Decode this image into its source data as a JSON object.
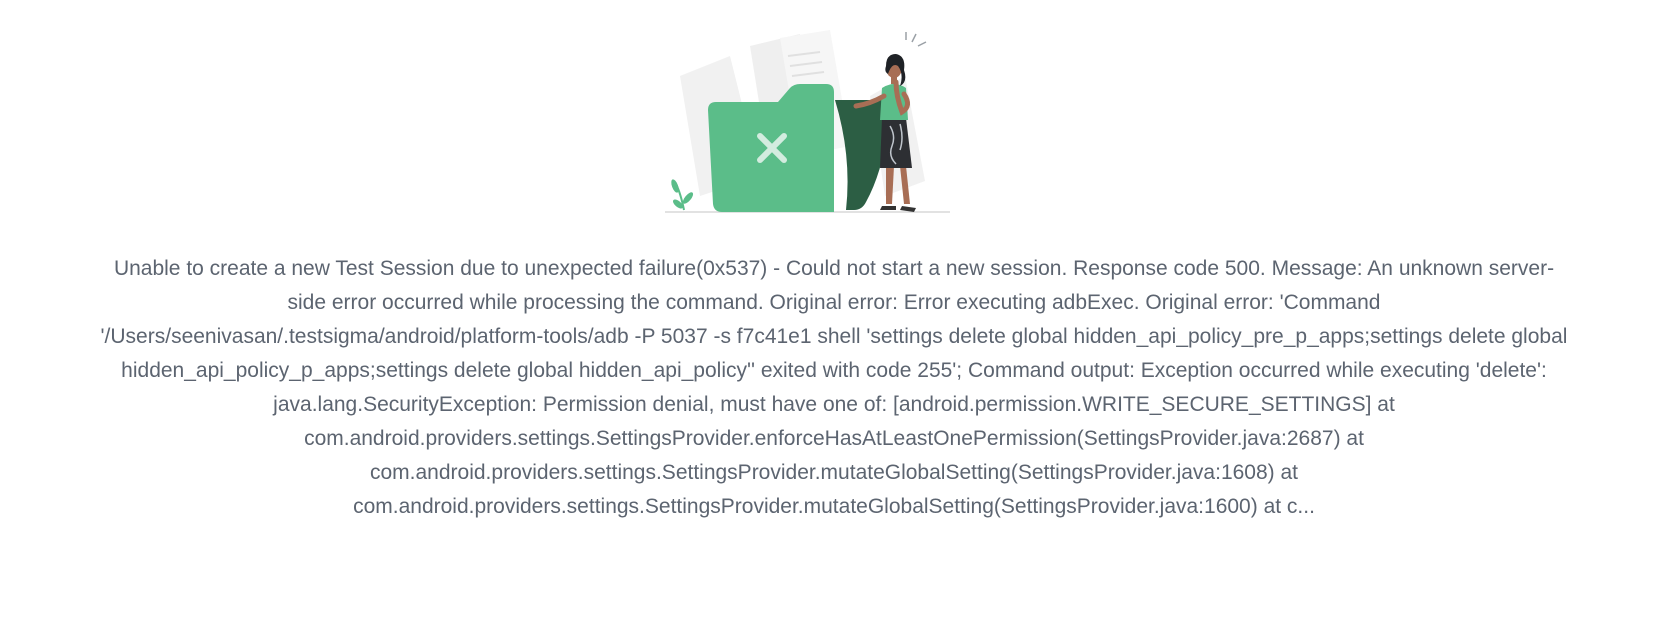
{
  "empty_state": {
    "illustration": {
      "icon": "error-folder-illustration",
      "accent_color": "#5bbd89",
      "dark_color": "#2c5e44"
    },
    "message": "Unable to create a new Test Session due to unexpected failure(0x537) - Could not start a new session. Response code 500. Message: An unknown server-side error occurred while processing the command. Original error: Error executing adbExec. Original error: 'Command '/Users/seenivasan/.testsigma/android/platform-tools/adb -P 5037 -s f7c41e1 shell 'settings delete global hidden_api_policy_pre_p_apps;settings delete global hidden_api_policy_p_apps;settings delete global hidden_api_policy'' exited with code 255'; Command output: Exception occurred while executing 'delete': java.lang.SecurityException: Permission denial, must have one of: [android.permission.WRITE_SECURE_SETTINGS] at com.android.providers.settings.SettingsProvider.enforceHasAtLeastOnePermission(SettingsProvider.java:2687) at com.android.providers.settings.SettingsProvider.mutateGlobalSetting(SettingsProvider.java:1608) at com.android.providers.settings.SettingsProvider.mutateGlobalSetting(SettingsProvider.java:1600) at c..."
  }
}
